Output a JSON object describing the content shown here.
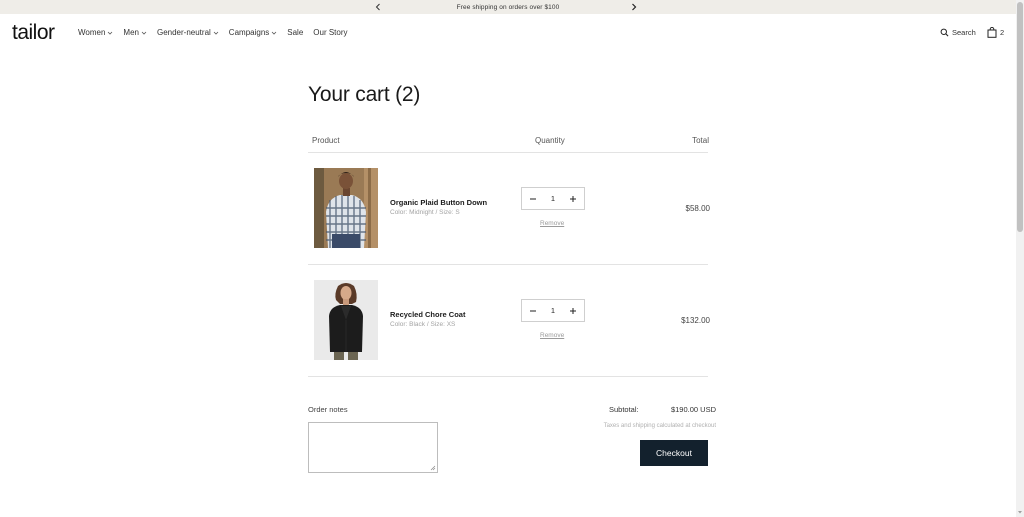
{
  "announcement": {
    "text": "Free shipping on orders over $100"
  },
  "header": {
    "logo": "tailor",
    "nav": [
      {
        "label": "Women",
        "dropdown": true
      },
      {
        "label": "Men",
        "dropdown": true
      },
      {
        "label": "Gender-neutral",
        "dropdown": true
      },
      {
        "label": "Campaigns",
        "dropdown": true
      },
      {
        "label": "Sale",
        "dropdown": false
      },
      {
        "label": "Our Story",
        "dropdown": false
      }
    ],
    "search_label": "Search",
    "cart_count": "2"
  },
  "cart": {
    "title": "Your cart (2)",
    "columns": {
      "product": "Product",
      "quantity": "Quantity",
      "total": "Total"
    },
    "items": [
      {
        "name": "Organic Plaid Button Down",
        "meta": "Color: Midnight  /  Size: S",
        "quantity": "1",
        "remove": "Remove",
        "price": "$58.00",
        "image_icon": "plaid-shirt-photo"
      },
      {
        "name": "Recycled Chore Coat",
        "meta": "Color: Black  /  Size: XS",
        "quantity": "1",
        "remove": "Remove",
        "price": "$132.00",
        "image_icon": "chore-coat-photo"
      }
    ],
    "notes_label": "Order notes",
    "notes_value": "",
    "subtotal_label": "Subtotal:",
    "subtotal_value": "$190.00 USD",
    "tax_note": "Taxes and shipping calculated at checkout",
    "checkout_label": "Checkout"
  },
  "colors": {
    "announcement_bg": "#efede8",
    "checkout_bg": "#13212d",
    "text": "#1c1c1c",
    "muted": "#a3a3a3"
  }
}
